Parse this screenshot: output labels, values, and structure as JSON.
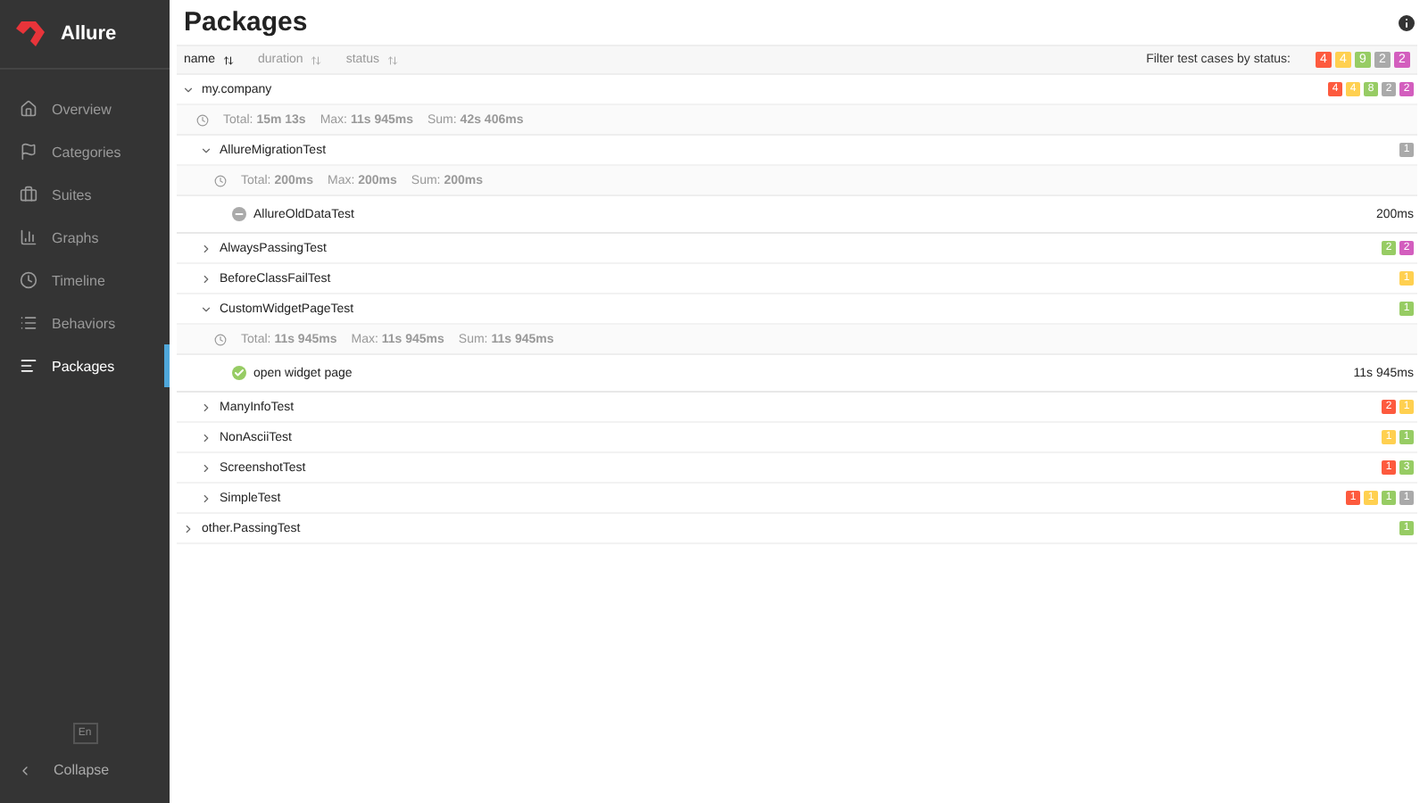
{
  "app": {
    "name": "Allure"
  },
  "sidebar": {
    "items": [
      {
        "label": "Overview",
        "selected": false
      },
      {
        "label": "Categories",
        "selected": false
      },
      {
        "label": "Suites",
        "selected": false
      },
      {
        "label": "Graphs",
        "selected": false
      },
      {
        "label": "Timeline",
        "selected": false
      },
      {
        "label": "Behaviors",
        "selected": false
      },
      {
        "label": "Packages",
        "selected": true
      }
    ],
    "language": "En",
    "collapse": "Collapse"
  },
  "page": {
    "title": "Packages"
  },
  "sort": [
    {
      "label": "name",
      "selected": true
    },
    {
      "label": "duration",
      "selected": false
    },
    {
      "label": "status",
      "selected": false
    }
  ],
  "filter": {
    "label": "Filter test cases by status:",
    "statuses": [
      {
        "color": "#fd5a3e",
        "count": "4"
      },
      {
        "color": "#ffd050",
        "count": "4"
      },
      {
        "color": "#97cc64",
        "count": "9"
      },
      {
        "color": "#aaaaaa",
        "count": "2"
      },
      {
        "color": "#d35ebe",
        "count": "2"
      }
    ]
  },
  "tree": [
    {
      "kind": "group",
      "name": "my.company",
      "expanded": true,
      "counts": [
        {
          "color": "#fd5a3e",
          "count": "4"
        },
        {
          "color": "#ffd050",
          "count": "4"
        },
        {
          "color": "#97cc64",
          "count": "8"
        },
        {
          "color": "#aaaaaa",
          "count": "2"
        },
        {
          "color": "#d35ebe",
          "count": "2"
        }
      ],
      "stats": [
        {
          "label": "Total:",
          "value": "15m 13s"
        },
        {
          "label": "Max:",
          "value": "11s 945ms"
        },
        {
          "label": "Sum:",
          "value": "42s 406ms"
        }
      ],
      "children": [
        {
          "kind": "group",
          "name": "AllureMigrationTest",
          "expanded": true,
          "counts": [
            {
              "color": "#aaaaaa",
              "count": "1"
            }
          ],
          "stats": [
            {
              "label": "Total:",
              "value": "200ms"
            },
            {
              "label": "Max:",
              "value": "200ms"
            },
            {
              "label": "Sum:",
              "value": "200ms"
            }
          ],
          "children": [
            {
              "kind": "skipped",
              "name": "AllureOldDataTest",
              "duration": "200ms"
            }
          ]
        },
        {
          "kind": "group",
          "name": "AlwaysPassingTest",
          "expanded": false,
          "counts": [
            {
              "color": "#97cc64",
              "count": "2"
            },
            {
              "color": "#d35ebe",
              "count": "2"
            }
          ]
        },
        {
          "kind": "group",
          "name": "BeforeClassFailTest",
          "expanded": false,
          "counts": [
            {
              "color": "#ffd050",
              "count": "1"
            }
          ]
        },
        {
          "kind": "group",
          "name": "CustomWidgetPageTest",
          "expanded": true,
          "counts": [
            {
              "color": "#97cc64",
              "count": "1"
            }
          ],
          "stats": [
            {
              "label": "Total:",
              "value": "11s 945ms"
            },
            {
              "label": "Max:",
              "value": "11s 945ms"
            },
            {
              "label": "Sum:",
              "value": "11s 945ms"
            }
          ],
          "children": [
            {
              "kind": "passed",
              "name": "open widget page",
              "duration": "11s 945ms"
            }
          ]
        },
        {
          "kind": "group",
          "name": "ManyInfoTest",
          "expanded": false,
          "counts": [
            {
              "color": "#fd5a3e",
              "count": "2"
            },
            {
              "color": "#ffd050",
              "count": "1"
            }
          ]
        },
        {
          "kind": "group",
          "name": "NonAsciiTest",
          "expanded": false,
          "counts": [
            {
              "color": "#ffd050",
              "count": "1"
            },
            {
              "color": "#97cc64",
              "count": "1"
            }
          ]
        },
        {
          "kind": "group",
          "name": "ScreenshotTest",
          "expanded": false,
          "counts": [
            {
              "color": "#fd5a3e",
              "count": "1"
            },
            {
              "color": "#97cc64",
              "count": "3"
            }
          ]
        },
        {
          "kind": "group",
          "name": "SimpleTest",
          "expanded": false,
          "counts": [
            {
              "color": "#fd5a3e",
              "count": "1"
            },
            {
              "color": "#ffd050",
              "count": "1"
            },
            {
              "color": "#97cc64",
              "count": "1"
            },
            {
              "color": "#aaaaaa",
              "count": "1"
            }
          ]
        }
      ]
    },
    {
      "kind": "group",
      "name": "other.PassingTest",
      "expanded": false,
      "counts": [
        {
          "color": "#97cc64",
          "count": "1"
        }
      ]
    }
  ]
}
